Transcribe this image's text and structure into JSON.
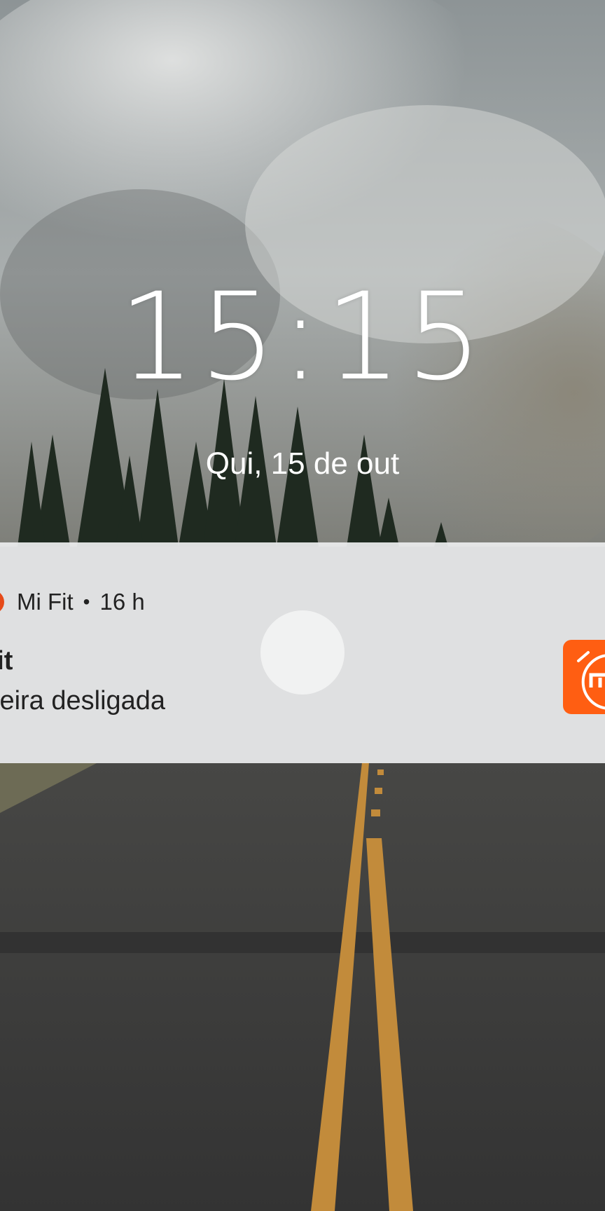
{
  "lockscreen": {
    "time": "15:15",
    "date": "Qui, 15 de out"
  },
  "notification": {
    "app_icon": "mi-fit-app-icon",
    "app_name": "Mi Fit",
    "separator": "•",
    "age": "16 h",
    "title": "Fit",
    "body": "lseira desligada",
    "large_icon": "mi-fit-logo-icon",
    "accent_color": "#FF5E12"
  },
  "colors": {
    "notification_background": "#ECEDEE",
    "text_primary": "#222222",
    "clock_text": "#FFFFFF"
  }
}
